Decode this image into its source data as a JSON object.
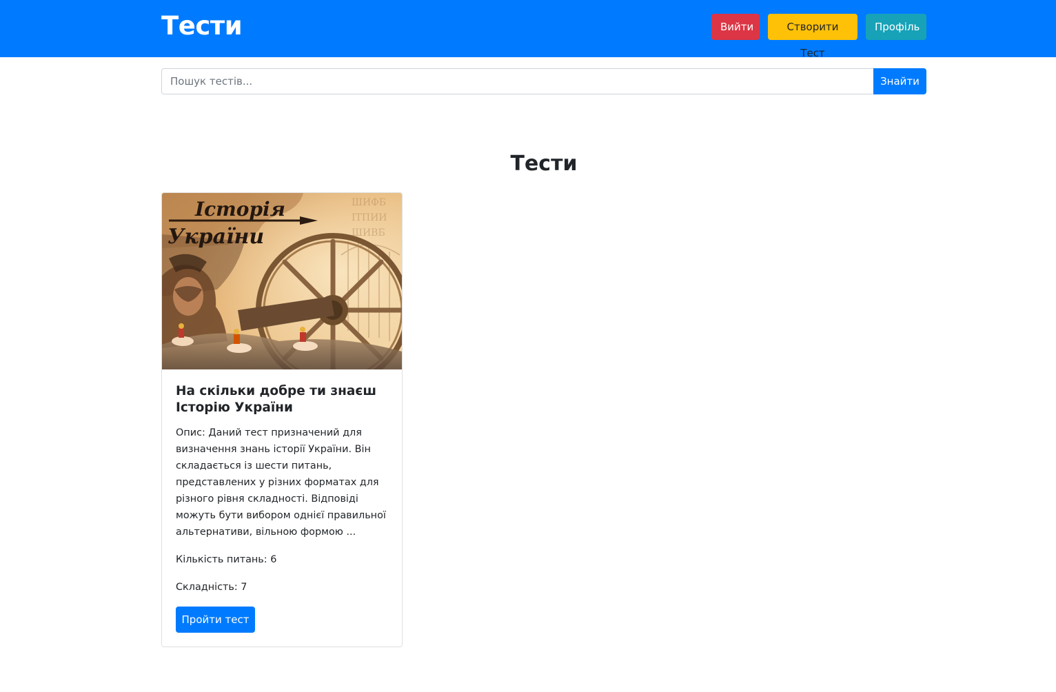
{
  "header": {
    "brand": "Тести",
    "buttons": {
      "logout": "Вийти",
      "create_test": "Створити Тест",
      "profile": "Профіль"
    }
  },
  "search": {
    "placeholder": "Пошук тестів...",
    "value": "",
    "button_label": "Знайти"
  },
  "main": {
    "title": "Тести",
    "tests": [
      {
        "image_caption_line1": "Історія",
        "image_caption_line2": "України",
        "title": "На скільки добре ти знаєш Історію України",
        "description": "Опис: Даний тест призначений для визначення знань історії України. Він складається із шести питань, представлених у різних форматах для різного рівня складності. Відповіді можуть бути вибором однієї правильної альтернативи, вільною формою ...",
        "questions_count": "Кількість питань: 6",
        "difficulty": "Складність: 7",
        "start_button": "Пройти тест"
      }
    ]
  },
  "colors": {
    "primary": "#007bff",
    "danger": "#dc3545",
    "warning": "#ffc107",
    "info": "#17a2b8"
  }
}
